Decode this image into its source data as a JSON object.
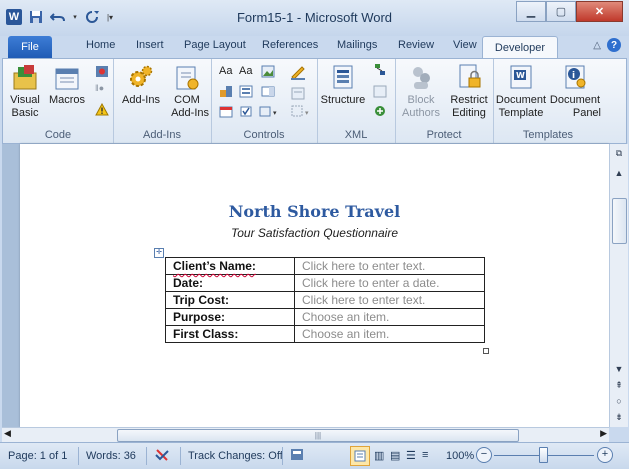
{
  "window": {
    "title": "Form15-1 - Microsoft Word"
  },
  "tabs": [
    "File",
    "Home",
    "Insert",
    "Page Layout",
    "References",
    "Mailings",
    "Review",
    "View",
    "Developer"
  ],
  "ribbon": {
    "code": {
      "label": "Code",
      "visual_basic": "Visual\nBasic",
      "visual_basic_l1": "Visual",
      "visual_basic_l2": "Basic",
      "macros": "Macros"
    },
    "addins": {
      "label": "Add-Ins",
      "addins_btn": "Add-Ins",
      "com_l1": "COM",
      "com_l2": "Add-Ins"
    },
    "controls": {
      "label": "Controls",
      "aa1": "Aa",
      "aa2": "Aa"
    },
    "xml": {
      "label": "XML",
      "structure": "Structure"
    },
    "protect": {
      "label": "Protect",
      "block_l1": "Block",
      "block_l2": "Authors",
      "restrict_l1": "Restrict",
      "restrict_l2": "Editing"
    },
    "templates": {
      "label": "Templates",
      "doctemplate_l1": "Document",
      "doctemplate_l2": "Template",
      "docpanel_l1": "Document",
      "docpanel_l2": "Panel"
    }
  },
  "document": {
    "heading": "North Shore Travel",
    "subheading": "Tour Satisfaction Questionnaire",
    "rows": [
      {
        "label": "Client’s Name:",
        "value": "Click here to enter text."
      },
      {
        "label": "Date:",
        "value": "Click here to enter a date."
      },
      {
        "label": "Trip Cost:",
        "value": "Click here to enter text."
      },
      {
        "label": "Purpose:",
        "value": "Choose an item."
      },
      {
        "label": "First Class:",
        "value": "Choose an item."
      }
    ]
  },
  "status": {
    "page": "Page: 1 of 1",
    "words": "Words: 36",
    "track_changes": "Track Changes: Off",
    "zoom": "100%"
  },
  "colors": {
    "heading": "#2e5aa0",
    "file_tab": "#1f5bb5",
    "placeholder": "#8c8c8c"
  }
}
